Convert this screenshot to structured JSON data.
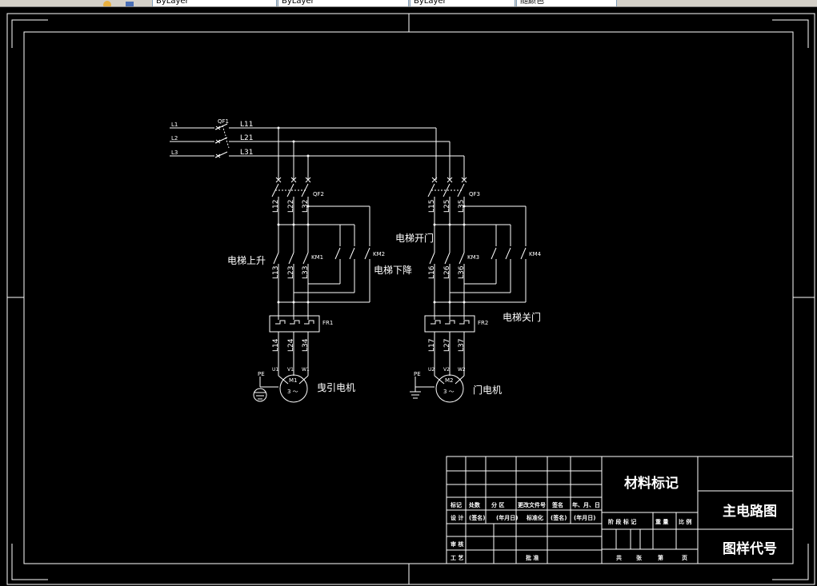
{
  "toolbar": {
    "icons": [
      "palette-icon",
      "cube-icon"
    ],
    "fields": [
      "ByLayer",
      "ByLayer",
      "ByLayer",
      "随颜色"
    ]
  },
  "supply": {
    "phases": [
      "L1",
      "L2",
      "L3"
    ],
    "breaker": "QF1",
    "outputs": [
      "L11",
      "L21",
      "L31"
    ]
  },
  "motor1": {
    "breaker": "QF2",
    "breaker_wires": [
      "L12",
      "L22",
      "L32"
    ],
    "contactor_up": "KM1",
    "contactor_down": "KM2",
    "contactor_wires": [
      "L13",
      "L23",
      "L33"
    ],
    "relay": "FR1",
    "relay_wires": [
      "L14",
      "L24",
      "L34"
    ],
    "terminals": [
      "U1",
      "V1",
      "W1"
    ],
    "motor_id": "M1",
    "motor_phase": "3 ～",
    "ground": "PE",
    "label_up": "电梯上升",
    "label_down": "电梯下降",
    "name": "曳引电机"
  },
  "motor2": {
    "breaker": "QF3",
    "breaker_wires": [
      "L15",
      "L25",
      "L35"
    ],
    "contactor_open": "KM3",
    "contactor_close": "KM4",
    "contactor_wires": [
      "L16",
      "L26",
      "L36"
    ],
    "relay": "FR2",
    "relay_wires": [
      "L17",
      "L27",
      "L37"
    ],
    "terminals": [
      "U2",
      "V2",
      "W2"
    ],
    "motor_id": "M2",
    "motor_phase": "3 ～",
    "ground": "PE",
    "label_open": "电梯开门",
    "label_close": "电梯关门",
    "name": "门电机"
  },
  "title_block": {
    "material": "材料标记",
    "drawing_name": "主电路图",
    "drawing_code": "图样代号",
    "row_marks": [
      "标记",
      "处数",
      "分 区",
      "更改文件号",
      "签名",
      "年、月、日"
    ],
    "row_design": [
      "设 计",
      "(签名)",
      "(年月日)",
      "标准化",
      "(签名)",
      "(年月日)"
    ],
    "row_review": "审 核",
    "row_process": "工 艺",
    "approve": "批 准",
    "stage_headers": [
      "阶 段 标 记",
      "重 量",
      "比 例"
    ],
    "sheet_line": [
      "共",
      "张",
      "第",
      "页"
    ]
  }
}
